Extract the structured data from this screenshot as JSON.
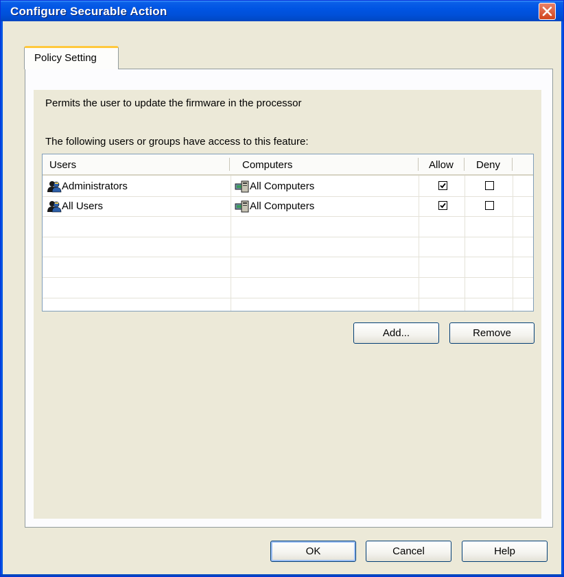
{
  "window": {
    "title": "Configure Securable Action"
  },
  "tabs": [
    {
      "label": "Policy Setting"
    }
  ],
  "description": "Permits the user to update the firmware in the processor",
  "access_label": "The following users or groups have access to this feature:",
  "table": {
    "columns": [
      "Users",
      "Computers",
      "Allow",
      "Deny"
    ],
    "rows": [
      {
        "user": "Administrators",
        "computer": "All Computers",
        "allow": true,
        "deny": false
      },
      {
        "user": "All Users",
        "computer": "All Computers",
        "allow": true,
        "deny": false
      }
    ]
  },
  "buttons": {
    "add": "Add...",
    "remove": "Remove",
    "ok": "OK",
    "cancel": "Cancel",
    "help": "Help"
  },
  "icons": {
    "close": "close-icon",
    "user": "users-group-icon",
    "computer": "computers-icon",
    "check": "check-mark-icon"
  },
  "colors": {
    "title_bar": "#0054e3",
    "close_button": "#d2441c",
    "tab_accent": "#ffc83c",
    "dialog_bg": "#ece9d8"
  }
}
